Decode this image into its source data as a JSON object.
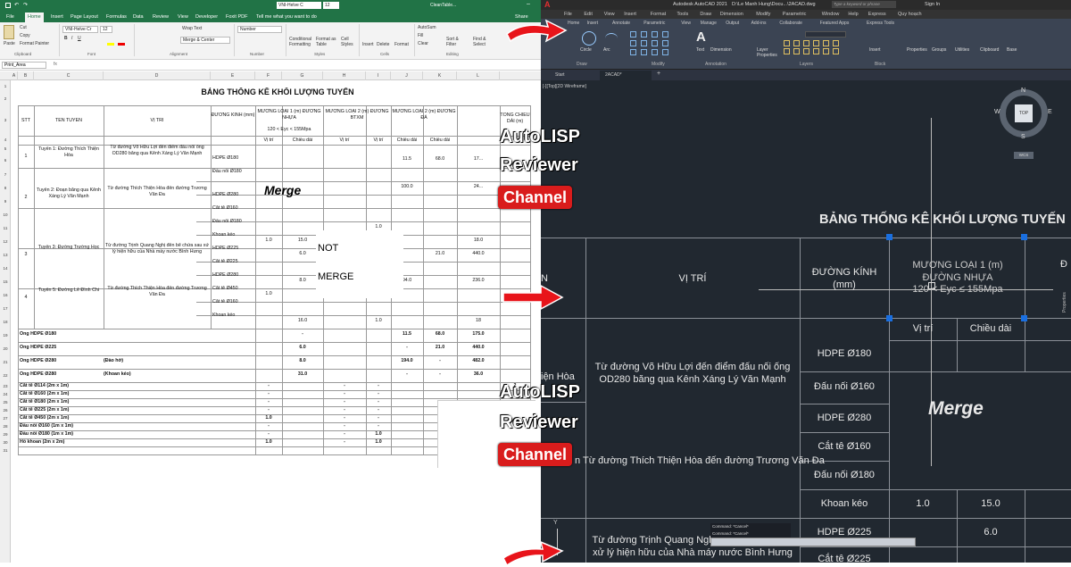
{
  "excel": {
    "title_font": "VNI-Helve C",
    "title_size": "12",
    "title_file": "CleanTable...",
    "tabs": [
      "File",
      "Home",
      "Insert",
      "Page Layout",
      "Formulas",
      "Data",
      "Review",
      "View",
      "Developer",
      "Foxit PDF"
    ],
    "tell_me": "Tell me what you want to do",
    "share": "Share",
    "ribbon": {
      "cut": "Cut",
      "copy": "Copy",
      "format_painter": "Format Painter",
      "paste": "Paste",
      "font_name": "VNI-Helve Cr",
      "font_size": "12",
      "wrap_text": "Wrap Text",
      "merge_center": "Merge & Center",
      "number_format": "Number",
      "conditional": "Conditional Formatting",
      "format_table": "Format as Table",
      "cell_styles": "Cell Styles",
      "insert": "Insert",
      "delete": "Delete",
      "format": "Format",
      "autosum": "AutoSum",
      "fill": "Fill",
      "clear": "Clear",
      "sort": "Sort & Filter",
      "find": "Find & Select",
      "groups": [
        "Clipboard",
        "Font",
        "Alignment",
        "Number",
        "Styles",
        "Cells",
        "Editing"
      ]
    },
    "name_box": "Print_Area",
    "columns": [
      "A",
      "B",
      "C",
      "D",
      "E",
      "F",
      "G",
      "H",
      "I",
      "J",
      "K",
      "L"
    ],
    "rows": [
      "1",
      "2",
      "3",
      "4",
      "5",
      "6",
      "7",
      "8",
      "9",
      "10",
      "11",
      "12",
      "13",
      "14",
      "15",
      "16",
      "17",
      "18",
      "19",
      "20",
      "21",
      "22",
      "23",
      "24",
      "25",
      "26",
      "27",
      "28",
      "29",
      "30",
      "31"
    ],
    "sheet_title": "BẢNG THỐNG KÊ KHỐI LƯỢNG TUYẾN",
    "headers": {
      "stt": "STT",
      "ten_tuyen": "TÊN TUYẾN",
      "vi_tri": "VỊ TRÍ",
      "duong_kinh": "ĐƯỜNG KÍNH (mm)",
      "muong1": "MƯƠNG LOẠI 1 (m) ĐƯỜNG NHỰA",
      "muong1_sub": "120 < Eyc < 155Mpa",
      "muong2a": "MƯƠNG LOẠI 2 (m) ĐƯỜNG BTXM",
      "muong2b": "MƯƠNG LOẠI 2 (m) ĐƯỜNG ĐÁ",
      "tong": "TỔNG CHIỀU DÀI (m)",
      "vi_tri_s": "Vị trí",
      "chieu_dai": "Chiều dài"
    },
    "stt": [
      "1",
      "2",
      "3",
      "4"
    ],
    "tuyen": [
      "Tuyến 1: Đường Thích Thiện Hòa",
      "Tuyến 2: Đoạn băng qua Kênh Xáng Lý Văn Mạnh",
      "Tuyến 3: Đường Trường Học",
      "Tuyến 5: Đường Lê Đình Chi"
    ],
    "vitri": [
      "Từ đường Võ Hữu Lợi đến điểm đấu nối ống OD280 băng qua Kênh Xáng Lý Văn Mạnh",
      "Từ đường Thích Thiện Hòa đến đường Trương Văn Đa",
      "Từ đường Trịnh Quang Nghị đến bể chứa sau xử lý hiện hữu của Nhà máy nước Bình Hưng",
      "Từ đường Thích Thiện Hòa đến đường Trương Văn Đa"
    ],
    "duongkinh": [
      "HDPE Ø180",
      "Đấu nối Ø180",
      "HDPE Ø280",
      "Cắt tê Ø160",
      "Đấu nối Ø180",
      "Khoan kéo",
      "HDPE Ø225",
      "Cắt tê Ø225",
      "HDPE Ø280",
      "Cắt tê Ø450",
      "Cắt tê Ø160",
      "Khoan kéo"
    ],
    "vals": {
      "r4_j": "11.5",
      "r4_k": "68.0",
      "r4_l": "17...",
      "r6_j": "100.0",
      "r6_l": "24...",
      "r9_i": "1.0",
      "r10_f": "1.0",
      "r10_g": "15.0",
      "r10_l": "18.0",
      "r11_g": "6.0",
      "r11_k": "21.0",
      "r11_l": "440.0",
      "r13_g": "8.0",
      "r13_j": "94.0",
      "r13_l": "236.0",
      "r14_f": "1.0",
      "r16_g": "16.0",
      "r16_i": "1.0",
      "r16_l": "18"
    },
    "merge_text": "Merge",
    "not_merge": [
      "NOT",
      "MERGE"
    ],
    "summary": [
      {
        "label": "Ống HDPE Ø180",
        "note": "",
        "g": "-",
        "j": "11.5",
        "k": "68.0",
        "l": "175.0"
      },
      {
        "label": "Ống HDPE Ø225",
        "note": "",
        "g": "6.0",
        "j": "-",
        "k": "21.0",
        "l": "440.0"
      },
      {
        "label": "Ống HDPE Ø280",
        "note": "(Đào hở)",
        "g": "8.0",
        "j": "194.0",
        "k": "-",
        "l": "482.0"
      },
      {
        "label": "Ống HDPE Ø280",
        "note": "(Khoan kéo)",
        "g": "31.0",
        "j": "-",
        "k": "-",
        "l": "36.0"
      }
    ],
    "fittings": [
      {
        "label": "Cắt tê Ø114 (2m x 1m)",
        "f": "-",
        "h": "-",
        "i": "-",
        "l": "2"
      },
      {
        "label": "Cắt tê Ø160 (2m x 1m)",
        "f": "-",
        "h": "-",
        "i": "-",
        "l": ""
      },
      {
        "label": "Cắt tê Ø180 (2m x 1m)",
        "f": "-",
        "h": "-",
        "i": "-",
        "l": ""
      },
      {
        "label": "Cắt tê Ø225 (2m x 1m)",
        "f": "-",
        "h": "-",
        "i": "-",
        "l": ""
      },
      {
        "label": "Cắt tê Ø450 (2m x 1m)",
        "f": "1.0",
        "h": "-",
        "i": "-",
        "l": ""
      },
      {
        "label": "Đấu nối Ø160 (1m x 1m)",
        "f": "-",
        "h": "-",
        "i": "-",
        "l": ""
      },
      {
        "label": "Đấu nối Ø180 (1m x 1m)",
        "f": "-",
        "h": "-",
        "i": "1.0",
        "l": ""
      },
      {
        "label": "Hố khoan (2m x 2m)",
        "f": "1.0",
        "h": "-",
        "i": "1.0",
        "l": ""
      }
    ]
  },
  "overlay": {
    "line1": "AutoLISP",
    "line2": "Reviewer",
    "line3": "Channel"
  },
  "acad": {
    "title": "Autodesk AutoCAD 2021",
    "path": "D:\\Le Manh Hung\\Docu...\\2ACAD.dwg",
    "search": "Type a keyword or phrase",
    "signin": "Sign In",
    "menus": [
      "File",
      "Edit",
      "View",
      "Insert",
      "Format",
      "Tools",
      "Draw",
      "Dimension",
      "Modify",
      "Parametric",
      "Window",
      "Help",
      "Express",
      "Quy hoạch"
    ],
    "ribbon_tabs": [
      "Home",
      "Insert",
      "Annotate",
      "Parametric",
      "View",
      "Manage",
      "Output",
      "Add-ins",
      "Collaborate",
      "Featured Apps",
      "Express Tools"
    ],
    "panels": [
      "Draw",
      "Modify",
      "Annotation",
      "Layers",
      "Block"
    ],
    "tools": [
      "Line",
      "Polyline",
      "Circle",
      "Arc",
      "Text",
      "Dimension",
      "Layer Properties",
      "Insert",
      "Properties",
      "Groups",
      "Utilities",
      "Clipboard",
      "Base"
    ],
    "doc_tabs": [
      "Start",
      "2ACAD*"
    ],
    "viewport_label": "[-][Top][2D Wireframe]",
    "compass": {
      "n": "N",
      "s": "S",
      "e": "E",
      "w": "W",
      "top": "TOP",
      "wcs": "WCS"
    },
    "table_title": "BẢNG THỐNG KÊ KHỐI LƯỢNG TUYẾN",
    "h_n": "N",
    "h_vitri": "VỊ TRÍ",
    "h_duongkinh": "ĐƯỜNG KÍNH (mm)",
    "h_muong1": "MƯƠNG LOẠI 1 (m) ĐƯỜNG NHỰA",
    "h_muong1_sub": "120 < Eyc ≤ 155Mpa",
    "h_vitri_s": "Vị trí",
    "h_chieudai": "Chiều dài",
    "h_cut": "Đ",
    "cell_hoa": "iện Hòa",
    "vitri1": "Từ đường Võ Hữu Lợi đến điểm đấu nối ống OD280 băng qua Kênh Xáng Lý Văn Mạnh",
    "vitri2": "n Từ đường Thích Thiện Hòa đến đường Trương Văn Đa",
    "vitri3": "Từ đường Trịnh Quang Nghị đến bể chứa sau xử lý hiện hữu của Nhà máy nước Bình Hưng",
    "dk": [
      "HDPE Ø180",
      "Đấu nối Ø160",
      "HDPE Ø280",
      "Cắt tê Ø160",
      "Đấu nối Ø180",
      "Khoan kéo",
      "HDPE Ø225",
      "Cắt tê Ø225"
    ],
    "khoan_vals": [
      "1.0",
      "15.0"
    ],
    "hdpe225_val": "6.0",
    "merge_text": "Merge",
    "cmd1": "Command: *Cancel*",
    "cmd2": "Command: *Cancel*",
    "properties_side": "Properties"
  }
}
